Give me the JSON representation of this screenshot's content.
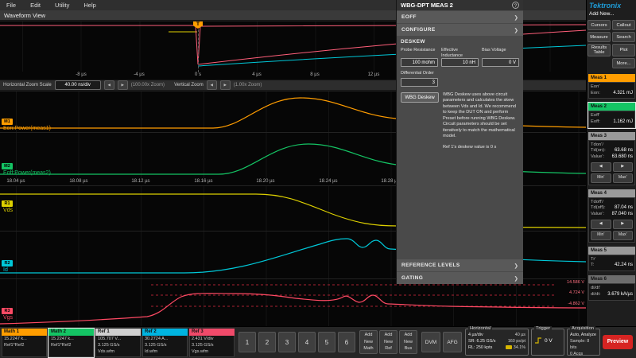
{
  "colors": {
    "brand_blue": "#1e9cd7",
    "math1_orange": "#ff9d00",
    "math2_green": "#14c464",
    "ref1_gray": "#cfcfcf",
    "ref2_cyan": "#00b4e0",
    "ref3_pink": "#f04a6a",
    "vds_yellow": "#ddd000",
    "id_cyan": "#00c8d8",
    "vgs_red": "#ff4a64",
    "meas_gray": "#9a9a9a",
    "preview_red": "#d62422"
  },
  "icons": {
    "chevron_right": "❯",
    "help": "?",
    "step_left": "◀",
    "step_right": "▶"
  },
  "menu": {
    "items": [
      "File",
      "Edit",
      "Utility",
      "Help"
    ]
  },
  "view_tab": "Waveform View",
  "overview": {
    "trigger_label": "T",
    "time_labels": [
      "-8 µs",
      "-4 µs",
      "0 s",
      "4 µs",
      "8 µs",
      "12 µs"
    ]
  },
  "zoom_bar": {
    "title": "Horizontal Zoom Scale",
    "scale_value": "40.00 ns/div",
    "h_zoom": "(100.00x Zoom)",
    "vertical_title": "Vertical Zoom",
    "v_zoom": "(1.00x Zoom)"
  },
  "traces": {
    "m1": {
      "badge": "M1",
      "label": "Eon:Power(meas1)"
    },
    "m2": {
      "badge": "M2",
      "label": "Eoff:Power(meas2)"
    },
    "r1": {
      "badge": "R1",
      "label": "Vds"
    },
    "r2": {
      "badge": "R2",
      "label": "Id"
    },
    "r3": {
      "badge": "R3",
      "label": "Vgs"
    }
  },
  "zoom_time_labels": [
    "18.04 µs",
    "18.08 µs",
    "18.12 µs",
    "18.16 µs",
    "18.20 µs",
    "18.24 µs",
    "18.28 µs"
  ],
  "ref_level_labels": [
    "14.586 V",
    "4.724 V",
    "-4.862 V"
  ],
  "panel": {
    "title": "WBG-DPT MEAS 2",
    "eoff": "EOFF",
    "configure": "CONFIGURE",
    "deskew_title": "DESKEW",
    "fields": [
      {
        "label": "Probe Resistance",
        "value": "100 mohm"
      },
      {
        "label": "Effective Inductance",
        "value": "10 nH"
      },
      {
        "label": "Bias Voltage",
        "value": "0 V"
      }
    ],
    "diff_order_label": "Differential Order",
    "diff_order_value": "3",
    "deskew_button": "WBG Deskew",
    "info": "WBG Deskew uses above circuit parameters and calculates the skew between Vds and Id. We recommend to keep the DUT ON and perform Preset before running WBG Deskew. Circuit parameters should be set iteratively to match the mathematical model.",
    "note": "Ref 1's deskew value is 0 s",
    "reference_levels": "REFERENCE LEVELS",
    "gating": "GATING"
  },
  "sidebar": {
    "brand": "Tektronix",
    "add_new": "Add New...",
    "buttons": [
      "Cursors",
      "Callout",
      "Measure",
      "Search",
      "Results Table",
      "Plot",
      "More..."
    ],
    "meas1": {
      "name": "Meas 1",
      "title": "Eon'",
      "label": "Eon:",
      "value": "4.321 mJ"
    },
    "meas2": {
      "name": "Meas 2",
      "title": "Eoff'",
      "label": "Eoff:",
      "value": "1.162 mJ"
    },
    "meas3": {
      "name": "Meas 3",
      "title": "Tdon'/",
      "label": "Td(on):",
      "value": "63.68 ns",
      "value_label": "Value':",
      "value2": "63.680 ns",
      "min": "Min'",
      "max": "Max'"
    },
    "meas4": {
      "name": "Meas 4",
      "title": "Tdoff'/",
      "label": "Td(off):",
      "value": "87.04 ns",
      "value_label": "Value':",
      "value2": "87.040 ns",
      "min": "Min'",
      "max": "Max'"
    },
    "meas5": {
      "name": "Meas 5",
      "title": "Tr'",
      "label": "T:",
      "value": "42.24 ns"
    },
    "meas6": {
      "name": "Meas 6",
      "title": "di/dt'",
      "label": "di/dt:",
      "value": "3.679 kA/µs"
    }
  },
  "bottom": {
    "math1": {
      "name": "Math 1",
      "l1": "15.2247 k...",
      "l2": "Ref1*Ref2"
    },
    "math2": {
      "name": "Math 2",
      "l1": "15.2247 k...",
      "l2": "Ref1*Ref2"
    },
    "ref1": {
      "name": "Ref 1",
      "l1": "105.707 V...",
      "l2": "3.125 GS/s",
      "l3": "Vds.wfm"
    },
    "ref2": {
      "name": "Ref 2",
      "l1": "30.2724 A...",
      "l2": "3.125 GS/s",
      "l3": "Id.wfm"
    },
    "ref3": {
      "name": "Ref 3",
      "l1": "2.431 V/div",
      "l2": "3.125 GS/s",
      "l3": "Vgs.wfm"
    },
    "channels": [
      "1",
      "2",
      "3",
      "4",
      "5",
      "6"
    ],
    "add_math": {
      "l1": "Add",
      "l2": "New",
      "l3": "Math"
    },
    "add_ref": {
      "l1": "Add",
      "l2": "New",
      "l3": "Ref"
    },
    "add_bus": {
      "l1": "Add",
      "l2": "New",
      "l3": "Bus"
    },
    "dvm": "DVM",
    "afg": "AFG",
    "horizontal": {
      "title": "Horizontal",
      "r1c1": "4 µs/div",
      "r1c2": "40 µs",
      "r2c1": "SR: 6.25 GS/s",
      "r2c2": "160 ps/pt",
      "r3c1": "RL: 250 kpts",
      "r3c2": "34.1%"
    },
    "trigger": {
      "title": "Trigger",
      "value": "0 V"
    },
    "acquisition": {
      "title": "Acquisition",
      "l1": "Auto, Analyze",
      "l2": "Sample: 8 bits",
      "l3": "0 Acqs"
    },
    "preview": "Preview"
  }
}
